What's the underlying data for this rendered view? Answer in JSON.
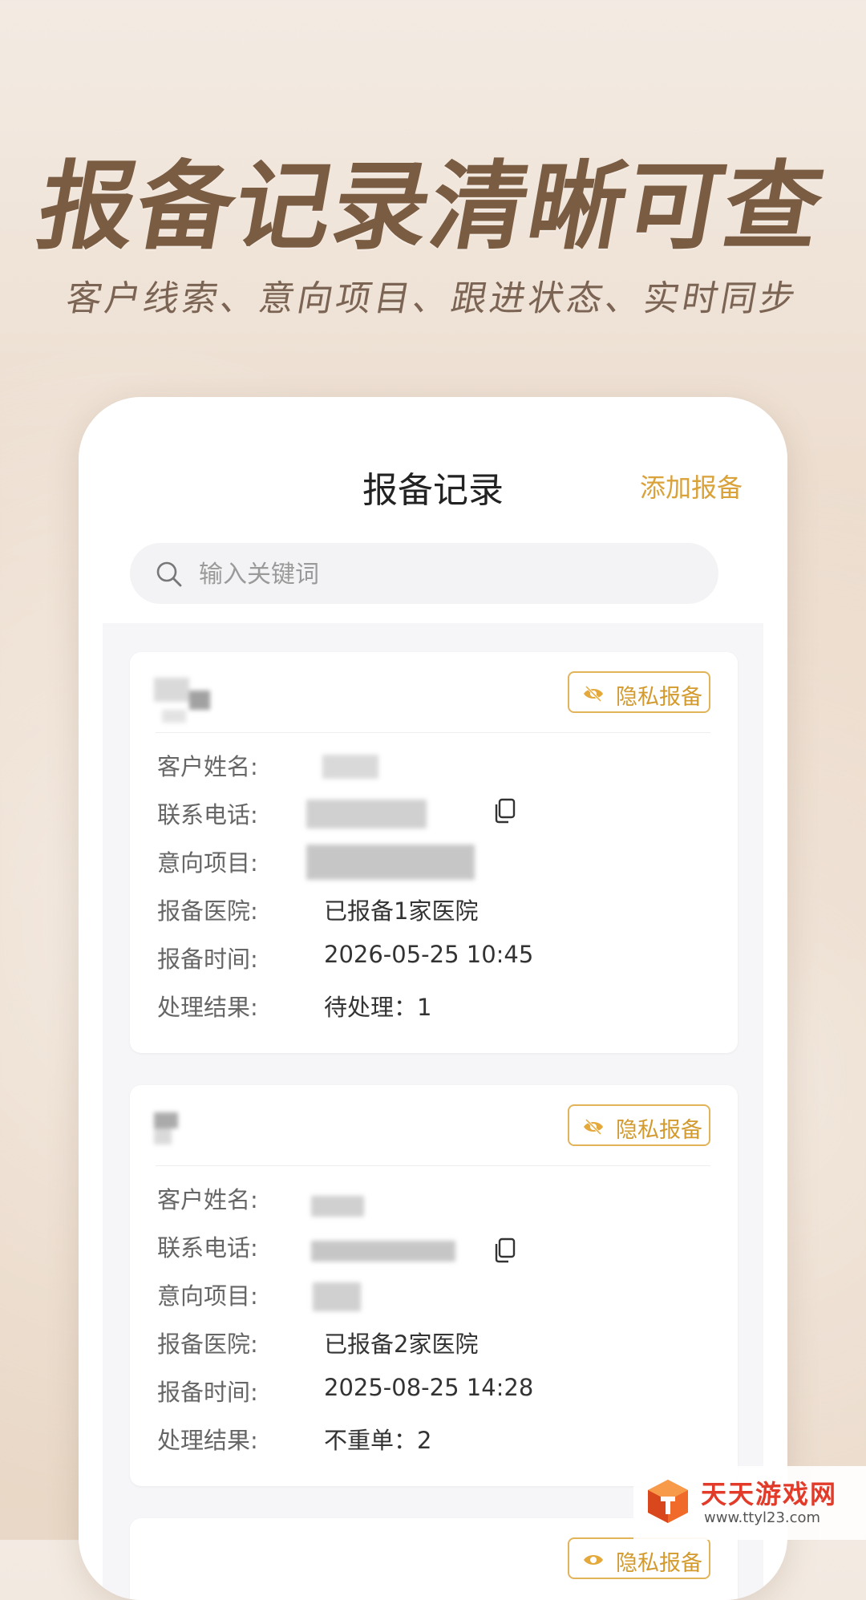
{
  "hero": {
    "title": "报备记录清晰可查",
    "subtitle": "客户线索、意向项目、跟进状态、实时同步"
  },
  "nav": {
    "title": "报备记录",
    "action_label": "添加报备"
  },
  "search": {
    "placeholder": "输入关键词",
    "icon": "search-icon"
  },
  "labels": {
    "customer_name": "客户姓名:",
    "phone": "联系电话:",
    "intended_project": "意向项目:",
    "hospital": "报备医院:",
    "time": "报备时间:",
    "result": "处理结果:"
  },
  "records": [
    {
      "badge": "隐私报备",
      "hospital": "已报备1家医院",
      "time": "2026-05-25 10:45",
      "result": "待处理：1"
    },
    {
      "badge": "隐私报备",
      "hospital": "已报备2家医院",
      "time": "2025-08-25 14:28",
      "result": "不重单：2"
    },
    {
      "badge": "隐私报备"
    }
  ],
  "watermark": {
    "name": "天天游戏网",
    "url": "www.ttyl23.com"
  },
  "colors": {
    "accent": "#d9a23b",
    "title_brown": "#7a5c43"
  }
}
